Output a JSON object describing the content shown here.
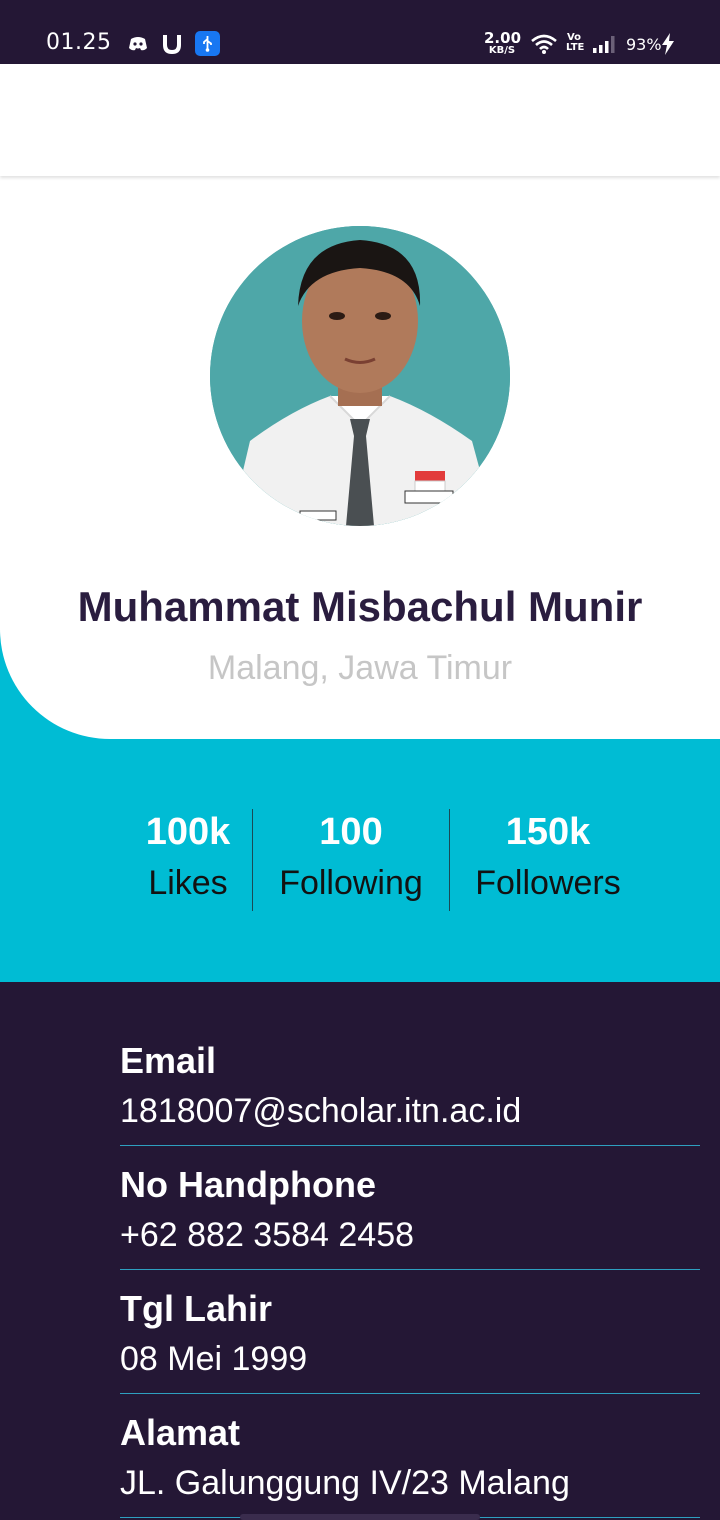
{
  "status_bar": {
    "time": "01.25",
    "speed_value": "2.00",
    "speed_unit": "KB/S",
    "battery": "93%",
    "lte_top": "Vo",
    "lte_bottom": "LTE"
  },
  "profile": {
    "name": "Muhammat Misbachul Munir",
    "location": "Malang, Jawa Timur"
  },
  "stats": [
    {
      "value": "100k",
      "label": "Likes"
    },
    {
      "value": "100",
      "label": "Following"
    },
    {
      "value": "150k",
      "label": "Followers"
    }
  ],
  "info": [
    {
      "label": "Email",
      "value": "1818007@scholar.itn.ac.id"
    },
    {
      "label": "No Handphone",
      "value": "+62 882 3584 2458"
    },
    {
      "label": "Tgl Lahir",
      "value": "08 Mei 1999"
    },
    {
      "label": "Alamat",
      "value": "JL. Galunggung IV/23 Malang"
    }
  ],
  "colors": {
    "dark_bg": "#241735",
    "accent_teal": "#00bcd4",
    "name_text": "#2a1d3f",
    "location_text": "#c6c6c6"
  }
}
